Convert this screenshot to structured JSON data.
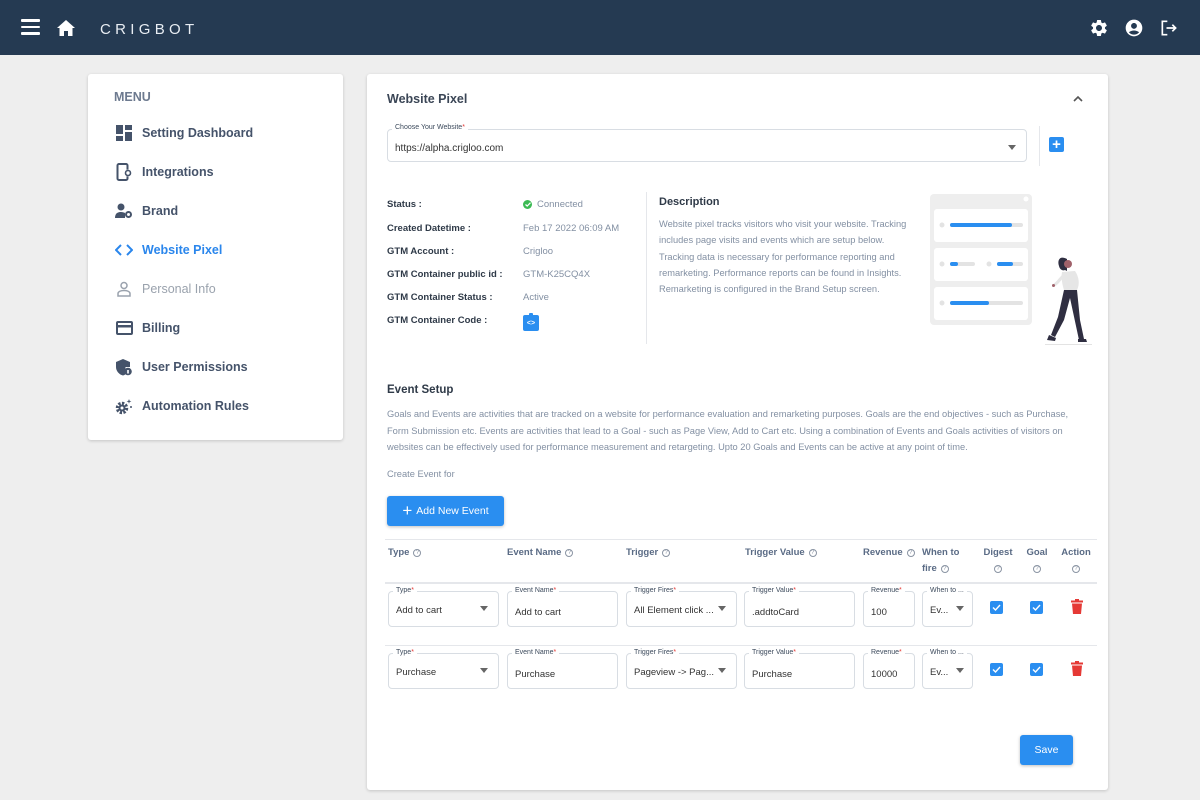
{
  "header": {
    "brand": "CRIGBOT",
    "icons": [
      "menu-icon",
      "home-icon",
      "gear-icon",
      "account-circle-icon",
      "logout-icon"
    ]
  },
  "sidebar": {
    "menu_label": "MENU",
    "items": [
      {
        "label": "Setting Dashboard",
        "icon": "dashboard-icon",
        "state": "normal"
      },
      {
        "label": "Integrations",
        "icon": "integrations-icon",
        "state": "normal"
      },
      {
        "label": "Brand",
        "icon": "brand-icon",
        "state": "normal"
      },
      {
        "label": "Website Pixel",
        "icon": "code-icon",
        "state": "active"
      },
      {
        "label": "Personal Info",
        "icon": "person-icon",
        "state": "disabled"
      },
      {
        "label": "Billing",
        "icon": "credit-card-icon",
        "state": "normal"
      },
      {
        "label": "User Permissions",
        "icon": "shield-lock-icon",
        "state": "normal"
      },
      {
        "label": "Automation Rules",
        "icon": "gear-sparkle-icon",
        "state": "normal"
      }
    ]
  },
  "panel": {
    "title": "Website Pixel",
    "website_select": {
      "label": "Choose Your Website",
      "required_mark": "*",
      "value": "https://alpha.crigloo.com"
    },
    "add_site_label": "+",
    "info": [
      {
        "key": "Status :",
        "value": "Connected"
      },
      {
        "key": "Created Datetime :",
        "value": "Feb 17 2022 06:09 AM"
      },
      {
        "key": "GTM Account :",
        "value": "Crigloo"
      },
      {
        "key": "GTM Container public id :",
        "value": "GTM-K25CQ4X"
      },
      {
        "key": "GTM Container Status :",
        "value": "Active"
      },
      {
        "key": "GTM Container Code :",
        "value": ""
      }
    ],
    "code_button_label": "<>",
    "description": {
      "title": "Description",
      "text": "Website pixel tracks visitors who visit your website. Tracking includes page visits and events which are setup below. Tracking data is necessary for performance reporting and remarketing. Performance reports can be found in Insights. Remarketing is configured in the Brand Setup screen."
    },
    "event_setup": {
      "title": "Event Setup",
      "text": "Goals and Events are activities that are tracked on a website for performance evaluation and remarketing purposes. Goals are the end objectives - such as Purchase, Form Submission etc. Events are activities that lead to a Goal - such as Page View, Add to Cart etc. Using a combination of Events and Goals activities of visitors on websites can be effectively used for performance measurement and retargeting. Upto 20 Goals and Events can be active at any point of time.",
      "create_for": "Create Event for",
      "add_button": "Add New Event",
      "add_button_plus": "+"
    },
    "table": {
      "help_glyph": "?",
      "columns": [
        "Type",
        "Event Name",
        "Trigger",
        "Trigger Value",
        "Revenue",
        "When to fire",
        "Digest",
        "Goal",
        "Action"
      ],
      "field_labels": {
        "type": "Type",
        "event_name": "Event Name",
        "trigger": "Trigger Fires",
        "trigger_value": "Trigger Value",
        "revenue": "Revenue",
        "when": "When to ..."
      },
      "required_mark": "*",
      "rows": [
        {
          "type": "Add to cart",
          "event_name": "Add to cart",
          "trigger": "All Element click ...",
          "trigger_value": ".addtoCard",
          "revenue": "100",
          "when": "Ev...",
          "digest": true,
          "goal": true
        },
        {
          "type": "Purchase",
          "event_name": "Purchase",
          "trigger": "Pageview -> Pag...",
          "trigger_value": "Purchase",
          "revenue": "10000",
          "when": "Ev...",
          "digest": true,
          "goal": true
        }
      ]
    },
    "save_label": "Save"
  },
  "colors": {
    "topbar": "#253a52",
    "accent": "#2a8ef0",
    "active_nav": "#2a86ec",
    "success": "#3cba54",
    "danger": "#e53935"
  }
}
